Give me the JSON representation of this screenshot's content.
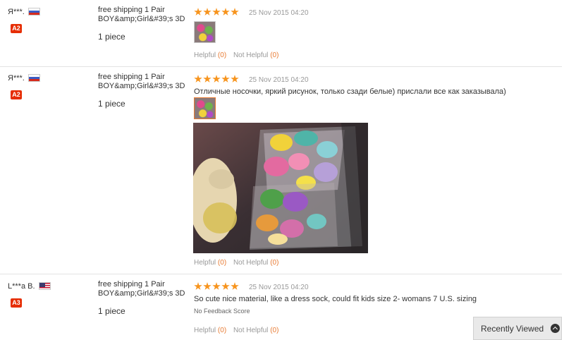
{
  "reviews": [
    {
      "buyer": "Я***.",
      "flag": "ru",
      "level": "A2",
      "product": "free shipping 1 Pair BOY&amp;Girl&#39;s 3D",
      "quantity": "1 piece",
      "rating": 5,
      "date": "25 Nov 2015 04:20",
      "comment": "",
      "helpful_label": "Helpful",
      "helpful_count": "(0)",
      "not_helpful_label": "Not Helpful",
      "not_helpful_count": "(0)"
    },
    {
      "buyer": "Я***.",
      "flag": "ru",
      "level": "A2",
      "product": "free shipping 1 Pair BOY&amp;Girl&#39;s 3D",
      "quantity": "1 piece",
      "rating": 5,
      "date": "25 Nov 2015 04:20",
      "comment": "Отличные носочки, яркий рисунок, только сзади белые) прислали все как заказывала)",
      "helpful_label": "Helpful",
      "helpful_count": "(0)",
      "not_helpful_label": "Not Helpful",
      "not_helpful_count": "(0)"
    },
    {
      "buyer": "L***a B.",
      "flag": "us",
      "level": "A3",
      "product": "free shipping 1 Pair BOY&amp;Girl&#39;s 3D",
      "quantity": "1 piece",
      "rating": 5,
      "date": "25 Nov 2015 04:20",
      "comment": "So cute nice material, like a dress sock, could fit kids size 2- womans 7 U.S. sizing",
      "no_feedback": "No Feedback Score",
      "helpful_label": "Helpful",
      "helpful_count": "(0)",
      "not_helpful_label": "Not Helpful",
      "not_helpful_count": "(0)"
    }
  ],
  "recently_viewed": {
    "label": "Recently Viewed",
    "icon": "chevron-up-circle-icon"
  },
  "colors": {
    "star": "#f7941d",
    "badge": "#e62e04",
    "count": "#e87b33"
  }
}
